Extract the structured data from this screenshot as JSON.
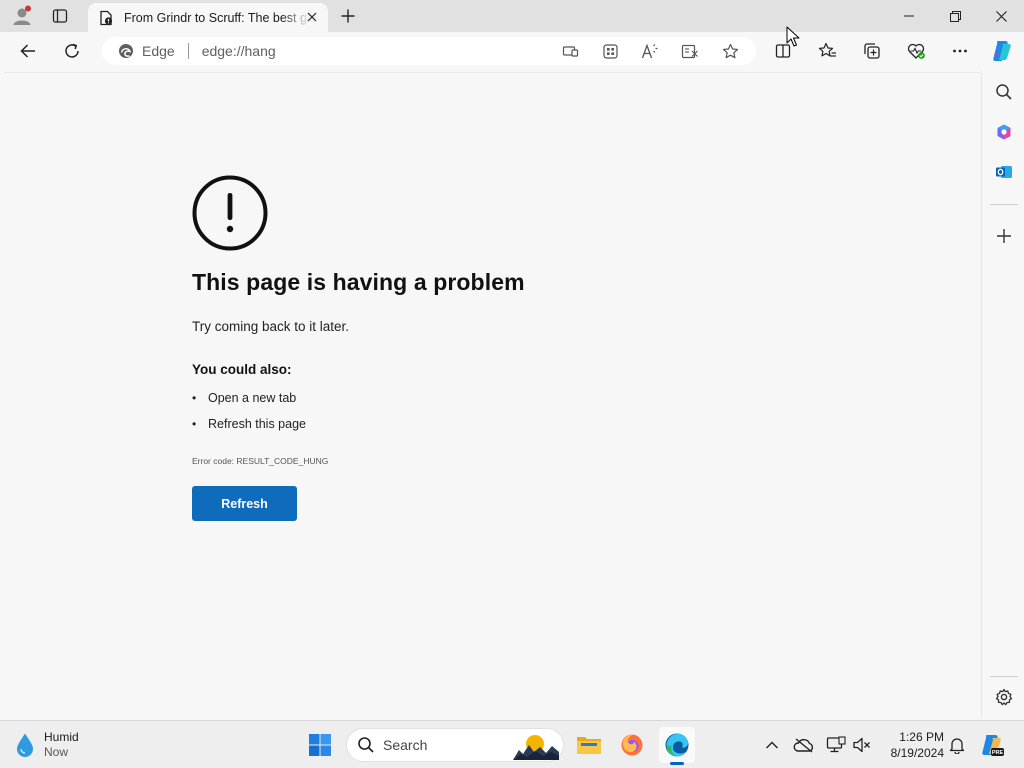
{
  "tab": {
    "title": "From Grindr to Scruff: The best gay dating apps",
    "close_icon": "close-icon"
  },
  "window": {
    "controls": [
      "minimize-icon",
      "maximize-icon",
      "close-icon"
    ]
  },
  "toolbar": {
    "site_label": "Edge",
    "url": "edge://hang",
    "address_icons": [
      "app-available-icon",
      "apps-grid-icon",
      "read-aloud-icon",
      "immersive-reader-icon",
      "favorite-star-icon"
    ],
    "right_icons": [
      "split-screen-icon",
      "favorites-icon",
      "collections-icon",
      "browser-essentials-icon",
      "more-icon",
      "copilot-icon"
    ]
  },
  "sidebar": {
    "icons": [
      "search-icon",
      "microsoft365-icon",
      "outlook-icon",
      "add-icon",
      "settings-icon"
    ]
  },
  "error_page": {
    "title": "This page is having a problem",
    "subtitle": "Try coming back to it later.",
    "also_heading": "You could also:",
    "suggestions": [
      "Open a new tab",
      "Refresh this page"
    ],
    "error_code": "Error code: RESULT_CODE_HUNG",
    "refresh_label": "Refresh"
  },
  "taskbar": {
    "weather": {
      "condition": "Humid",
      "time": "Now"
    },
    "search_label": "Search",
    "pinned": [
      "start-icon",
      "file-explorer-icon",
      "firefox-icon",
      "edge-icon"
    ],
    "clock": {
      "time": "1:26 PM",
      "date": "8/19/2024"
    }
  },
  "colors": {
    "accent": "#0f6cbd",
    "page_bg": "#f7f7f7",
    "titlebar_bg": "#e1e1e1"
  }
}
